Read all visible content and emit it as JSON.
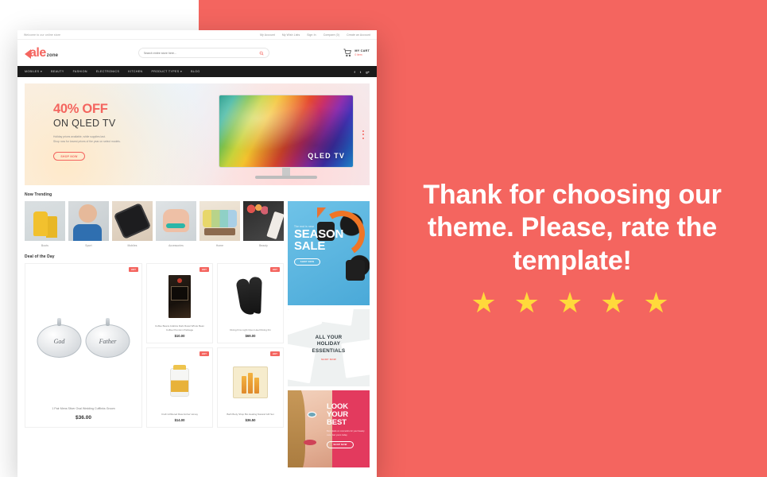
{
  "promo": {
    "heading": "Thank for choosing our theme. Please, rate the template!",
    "stars": "★ ★ ★ ★ ★",
    "accent_color": "#f4655f",
    "star_color": "#ffd93b"
  },
  "site": {
    "topbar": {
      "welcome": "Welcome to our online store",
      "links": [
        "My Account",
        "My Wish Lists",
        "Sign In",
        "Compare (0)",
        "Create an Account"
      ]
    },
    "header": {
      "logo_main": "ale",
      "logo_sub": "zone",
      "search_placeholder": "Search entire store here...",
      "search_icon": "search-icon",
      "cart_icon": "cart-icon",
      "cart_title": "MY CART",
      "cart_count": "0 item"
    },
    "nav": {
      "items": [
        "MOBILES",
        "BEAUTY",
        "FASHION",
        "ELECTRONICS",
        "KITCHEN",
        "PRODUCT TYPES",
        "BLOG"
      ],
      "dropdown_indices": [
        0,
        5
      ],
      "social": [
        "f",
        "t",
        "g+"
      ]
    },
    "hero": {
      "title": "40% OFF",
      "subtitle": "ON QLED TV",
      "line1": "Holiday prices available, while supplies last.",
      "line2": "Shop now for lowest prices of the year on select models.",
      "button": "SHOP NOW",
      "tv_label": "QLED TV"
    },
    "trending": {
      "title": "Now Trending",
      "items": [
        {
          "label": "Boots",
          "art": "t-boots"
        },
        {
          "label": "Sport",
          "art": "t-sport"
        },
        {
          "label": "Mobiles",
          "art": "t-mobile"
        },
        {
          "label": "Accessories",
          "art": "t-acc"
        },
        {
          "label": "Home",
          "art": "t-home"
        },
        {
          "label": "Beauty",
          "art": "t-beauty"
        }
      ]
    },
    "deal": {
      "title": "Deal of the Day",
      "badge": "HOT",
      "featured": {
        "title": "1 Pair Mens Silver Oval Wedding Cufflinks Groom",
        "price": "$36.00",
        "cuff_text_left": "God",
        "cuff_text_right": "Father"
      },
      "products": [
        {
          "title": "Coffee Beans Arabica Dark Roast Whole Bean Coffee Premium Package",
          "price": "$10.00"
        },
        {
          "title": "Diving Fins Light Open Heel Diving Fin",
          "price": "$69.00"
        },
        {
          "title": "Craft Unfiltered Raw Amber Honey",
          "price": "$14.00"
        },
        {
          "title": "Bath Body Shop Bio Healing Natural Gift Set",
          "price": "$36.50"
        }
      ]
    },
    "banners": [
      {
        "kicker": "The end is near",
        "line1": "SEASON",
        "line2": "SALE",
        "button": "SHOP NOW"
      },
      {
        "line1": "ALL YOUR",
        "line2": "HOLIDAY",
        "line3": "ESSENTIALS",
        "button": "SHOP NOW"
      },
      {
        "line1": "LOOK",
        "line2": "YOUR",
        "line3": "BEST",
        "text": "Best deals on cosmetics for your beauty care. Get yours today.",
        "button": "SHOP NOW"
      }
    ]
  }
}
